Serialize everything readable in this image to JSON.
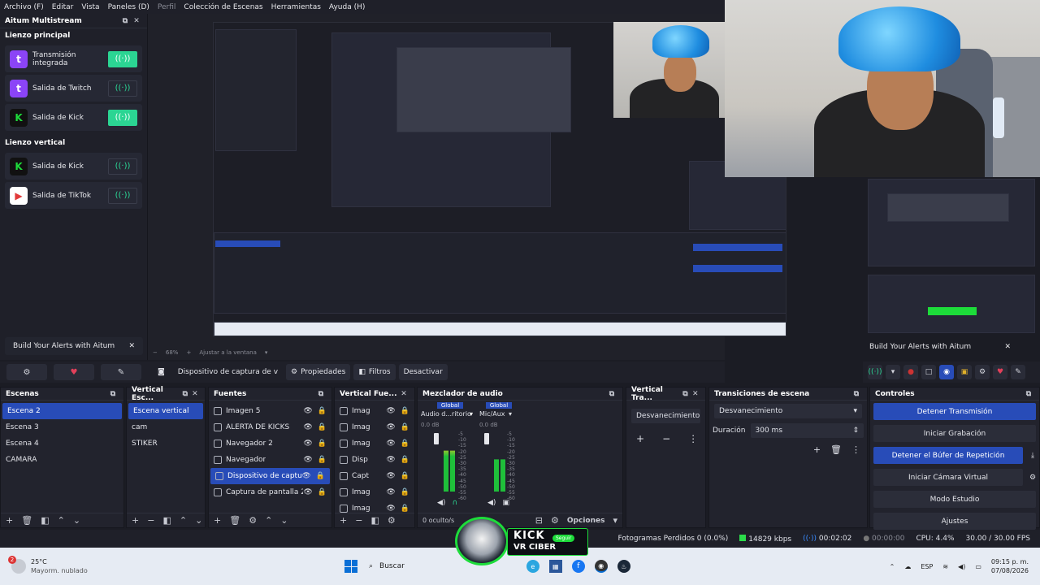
{
  "menubar": {
    "items": [
      "Archivo (F)",
      "Editar",
      "Vista",
      "Paneles (D)",
      "Perfil",
      "Colección de Escenas",
      "Herramientas",
      "Ayuda (H)"
    ]
  },
  "multistream": {
    "title": "Aitum Multistream",
    "main_canvas": "Lienzo principal",
    "vertical_canvas": "Lienzo vertical",
    "main_outputs": [
      {
        "label": "Transmisión integrada",
        "logo": "twitch-icon",
        "logo_text": "t",
        "color": "#8b44f7",
        "on": true
      },
      {
        "label": "Salida de Twitch",
        "logo": "twitch-icon",
        "logo_text": "t",
        "color": "#8b44f7",
        "on": false
      },
      {
        "label": "Salida de Kick",
        "logo": "kick-icon",
        "logo_text": "K",
        "color": "#1ddc3a",
        "on": true
      }
    ],
    "vertical_outputs": [
      {
        "label": "Salida de Kick",
        "logo": "kick-icon",
        "logo_text": "K",
        "color": "#1ddc3a",
        "on": false
      },
      {
        "label": "Salida de TikTok",
        "logo": "tiktok-icon",
        "logo_text": "▶",
        "color": "#e23a3a",
        "on": false
      }
    ],
    "alert_banner": "Build Your Alerts with Aitum"
  },
  "preview": {
    "zoom": "68%",
    "fit_label": "Ajustar a la ventana",
    "right_alert": "Build Your Alerts with Aitum"
  },
  "sourcebar": {
    "source_name": "Dispositivo de captura de v",
    "properties": "Propiedades",
    "filters": "Filtros",
    "deactivate": "Desactivar"
  },
  "scenes": {
    "title": "Escenas",
    "items": [
      "Escena 2",
      "Escena 3",
      "Escena 4",
      "CAMARA"
    ],
    "selected": 0
  },
  "vertical_scenes": {
    "title": "Vertical Esc...",
    "items": [
      "Escena vertical",
      "cam",
      "STIKER"
    ],
    "selected": 0
  },
  "sources": {
    "title": "Fuentes",
    "items": [
      "Imagen 5",
      "ALERTA DE KICKS",
      "Navegador 2",
      "Navegador",
      "Dispositivo de captura",
      "Captura de pantalla 2"
    ],
    "selected": 4
  },
  "vertical_sources": {
    "title": "Vertical Fue...",
    "items": [
      "Imag",
      "Imag",
      "Imag",
      "Disp",
      "Capt",
      "Imag",
      "Imag"
    ]
  },
  "mixer": {
    "title": "Mezclador de audio",
    "channels": [
      {
        "badge": "Global",
        "name": "Audio d...ritorio",
        "db": "0.0 dB",
        "level": 0.7
      },
      {
        "badge": "Global",
        "name": "Mic/Aux",
        "db": "0.0 dB",
        "level": 0.55
      }
    ],
    "scale": [
      "-5",
      "-10",
      "-15",
      "-20",
      "-25",
      "-30",
      "-35",
      "-40",
      "-45",
      "-50",
      "-55",
      "-60"
    ],
    "hidden": "0 oculto/s",
    "options": "Opciones"
  },
  "vertical_transitions": {
    "title": "Vertical Tra...",
    "value": "Desvanecimiento"
  },
  "transitions": {
    "title": "Transiciones de escena",
    "value": "Desvanecimiento",
    "duration_label": "Duración",
    "duration_value": "300 ms"
  },
  "controls": {
    "title": "Controles",
    "buttons": [
      {
        "label": "Detener Transmisión",
        "active": true
      },
      {
        "label": "Iniciar Grabación",
        "active": false
      },
      {
        "label": "Detener el Búfer de Repetición",
        "active": true
      },
      {
        "label": "Iniciar Cámara Virtual",
        "active": false
      },
      {
        "label": "Modo Estudio",
        "active": false
      },
      {
        "label": "Ajustes",
        "active": false
      }
    ]
  },
  "status": {
    "dropped": "Fotogramas Perdidos 0 (0.0%)",
    "bitrate": "14829 kbps",
    "stream_time": "00:02:02",
    "rec_time": "00:00:00",
    "cpu": "CPU: 4.4%",
    "fps": "30.00 / 30.00 FPS"
  },
  "kick_overlay": {
    "line1": "KICK",
    "line2": "VR CIBER",
    "badge": "Seguir"
  },
  "taskbar": {
    "weather_temp": "25°C",
    "weather_desc": "Mayorm. nublado",
    "weather_badge": "2",
    "search": "Buscar",
    "lang": "ESP",
    "time": "09:15 p. m.",
    "date": "07/08/2026"
  },
  "colors": {
    "accent_blue": "#284cb8",
    "aitum_green": "#2bd593",
    "kick_green": "#1ddc3a"
  }
}
